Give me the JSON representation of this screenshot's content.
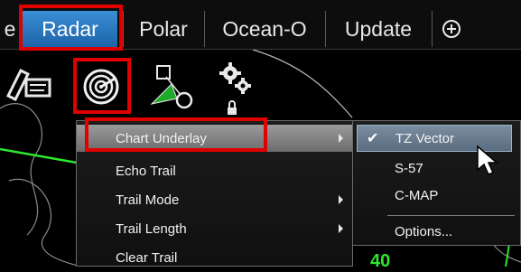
{
  "tabs": [
    {
      "label": "e",
      "active": false
    },
    {
      "label": "Radar",
      "active": true
    },
    {
      "label": "Polar",
      "active": false
    },
    {
      "label": "Ocean-O",
      "active": false
    },
    {
      "label": "Update",
      "active": false
    }
  ],
  "add_tab_icon": "plus-circle-icon",
  "toolbar": {
    "icons": [
      "draw-tools-icon",
      "radar-overlay-icon",
      "ship-vector-icon",
      "settings-locked-icon"
    ]
  },
  "menu": {
    "items": [
      {
        "label": "Chart Underlay",
        "has_submenu": true,
        "highlighted": true
      },
      {
        "label": "Echo Trail",
        "has_submenu": false
      },
      {
        "label": "Trail Mode",
        "has_submenu": true
      },
      {
        "label": "Trail Length",
        "has_submenu": true
      },
      {
        "label": "Clear Trail",
        "has_submenu": false
      }
    ]
  },
  "submenu": {
    "items": [
      {
        "label": "TZ Vector",
        "checked": true,
        "highlighted": true
      },
      {
        "label": "S-57",
        "checked": false
      },
      {
        "label": "C-MAP",
        "checked": false
      },
      {
        "label": "Options...",
        "checked": false
      }
    ]
  },
  "map_value": "40",
  "colors": {
    "highlight_red": "#e00000",
    "tab_active": "#2a78c4",
    "green_line": "#2ee62e"
  }
}
